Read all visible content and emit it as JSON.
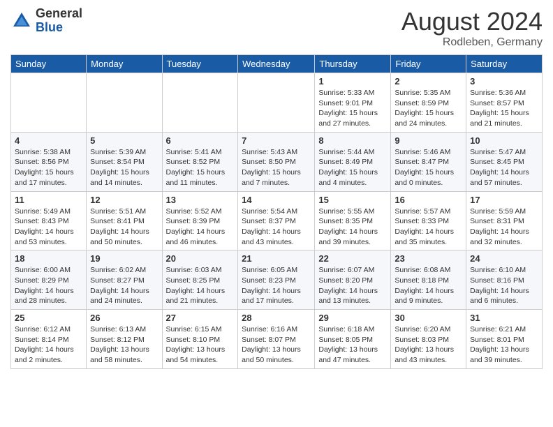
{
  "header": {
    "logo_general": "General",
    "logo_blue": "Blue",
    "month_title": "August 2024",
    "location": "Rodleben, Germany"
  },
  "weekdays": [
    "Sunday",
    "Monday",
    "Tuesday",
    "Wednesday",
    "Thursday",
    "Friday",
    "Saturday"
  ],
  "weeks": [
    [
      {
        "day": "",
        "info": ""
      },
      {
        "day": "",
        "info": ""
      },
      {
        "day": "",
        "info": ""
      },
      {
        "day": "",
        "info": ""
      },
      {
        "day": "1",
        "info": "Sunrise: 5:33 AM\nSunset: 9:01 PM\nDaylight: 15 hours\nand 27 minutes."
      },
      {
        "day": "2",
        "info": "Sunrise: 5:35 AM\nSunset: 8:59 PM\nDaylight: 15 hours\nand 24 minutes."
      },
      {
        "day": "3",
        "info": "Sunrise: 5:36 AM\nSunset: 8:57 PM\nDaylight: 15 hours\nand 21 minutes."
      }
    ],
    [
      {
        "day": "4",
        "info": "Sunrise: 5:38 AM\nSunset: 8:56 PM\nDaylight: 15 hours\nand 17 minutes."
      },
      {
        "day": "5",
        "info": "Sunrise: 5:39 AM\nSunset: 8:54 PM\nDaylight: 15 hours\nand 14 minutes."
      },
      {
        "day": "6",
        "info": "Sunrise: 5:41 AM\nSunset: 8:52 PM\nDaylight: 15 hours\nand 11 minutes."
      },
      {
        "day": "7",
        "info": "Sunrise: 5:43 AM\nSunset: 8:50 PM\nDaylight: 15 hours\nand 7 minutes."
      },
      {
        "day": "8",
        "info": "Sunrise: 5:44 AM\nSunset: 8:49 PM\nDaylight: 15 hours\nand 4 minutes."
      },
      {
        "day": "9",
        "info": "Sunrise: 5:46 AM\nSunset: 8:47 PM\nDaylight: 15 hours\nand 0 minutes."
      },
      {
        "day": "10",
        "info": "Sunrise: 5:47 AM\nSunset: 8:45 PM\nDaylight: 14 hours\nand 57 minutes."
      }
    ],
    [
      {
        "day": "11",
        "info": "Sunrise: 5:49 AM\nSunset: 8:43 PM\nDaylight: 14 hours\nand 53 minutes."
      },
      {
        "day": "12",
        "info": "Sunrise: 5:51 AM\nSunset: 8:41 PM\nDaylight: 14 hours\nand 50 minutes."
      },
      {
        "day": "13",
        "info": "Sunrise: 5:52 AM\nSunset: 8:39 PM\nDaylight: 14 hours\nand 46 minutes."
      },
      {
        "day": "14",
        "info": "Sunrise: 5:54 AM\nSunset: 8:37 PM\nDaylight: 14 hours\nand 43 minutes."
      },
      {
        "day": "15",
        "info": "Sunrise: 5:55 AM\nSunset: 8:35 PM\nDaylight: 14 hours\nand 39 minutes."
      },
      {
        "day": "16",
        "info": "Sunrise: 5:57 AM\nSunset: 8:33 PM\nDaylight: 14 hours\nand 35 minutes."
      },
      {
        "day": "17",
        "info": "Sunrise: 5:59 AM\nSunset: 8:31 PM\nDaylight: 14 hours\nand 32 minutes."
      }
    ],
    [
      {
        "day": "18",
        "info": "Sunrise: 6:00 AM\nSunset: 8:29 PM\nDaylight: 14 hours\nand 28 minutes."
      },
      {
        "day": "19",
        "info": "Sunrise: 6:02 AM\nSunset: 8:27 PM\nDaylight: 14 hours\nand 24 minutes."
      },
      {
        "day": "20",
        "info": "Sunrise: 6:03 AM\nSunset: 8:25 PM\nDaylight: 14 hours\nand 21 minutes."
      },
      {
        "day": "21",
        "info": "Sunrise: 6:05 AM\nSunset: 8:23 PM\nDaylight: 14 hours\nand 17 minutes."
      },
      {
        "day": "22",
        "info": "Sunrise: 6:07 AM\nSunset: 8:20 PM\nDaylight: 14 hours\nand 13 minutes."
      },
      {
        "day": "23",
        "info": "Sunrise: 6:08 AM\nSunset: 8:18 PM\nDaylight: 14 hours\nand 9 minutes."
      },
      {
        "day": "24",
        "info": "Sunrise: 6:10 AM\nSunset: 8:16 PM\nDaylight: 14 hours\nand 6 minutes."
      }
    ],
    [
      {
        "day": "25",
        "info": "Sunrise: 6:12 AM\nSunset: 8:14 PM\nDaylight: 14 hours\nand 2 minutes."
      },
      {
        "day": "26",
        "info": "Sunrise: 6:13 AM\nSunset: 8:12 PM\nDaylight: 13 hours\nand 58 minutes."
      },
      {
        "day": "27",
        "info": "Sunrise: 6:15 AM\nSunset: 8:10 PM\nDaylight: 13 hours\nand 54 minutes."
      },
      {
        "day": "28",
        "info": "Sunrise: 6:16 AM\nSunset: 8:07 PM\nDaylight: 13 hours\nand 50 minutes."
      },
      {
        "day": "29",
        "info": "Sunrise: 6:18 AM\nSunset: 8:05 PM\nDaylight: 13 hours\nand 47 minutes."
      },
      {
        "day": "30",
        "info": "Sunrise: 6:20 AM\nSunset: 8:03 PM\nDaylight: 13 hours\nand 43 minutes."
      },
      {
        "day": "31",
        "info": "Sunrise: 6:21 AM\nSunset: 8:01 PM\nDaylight: 13 hours\nand 39 minutes."
      }
    ]
  ]
}
